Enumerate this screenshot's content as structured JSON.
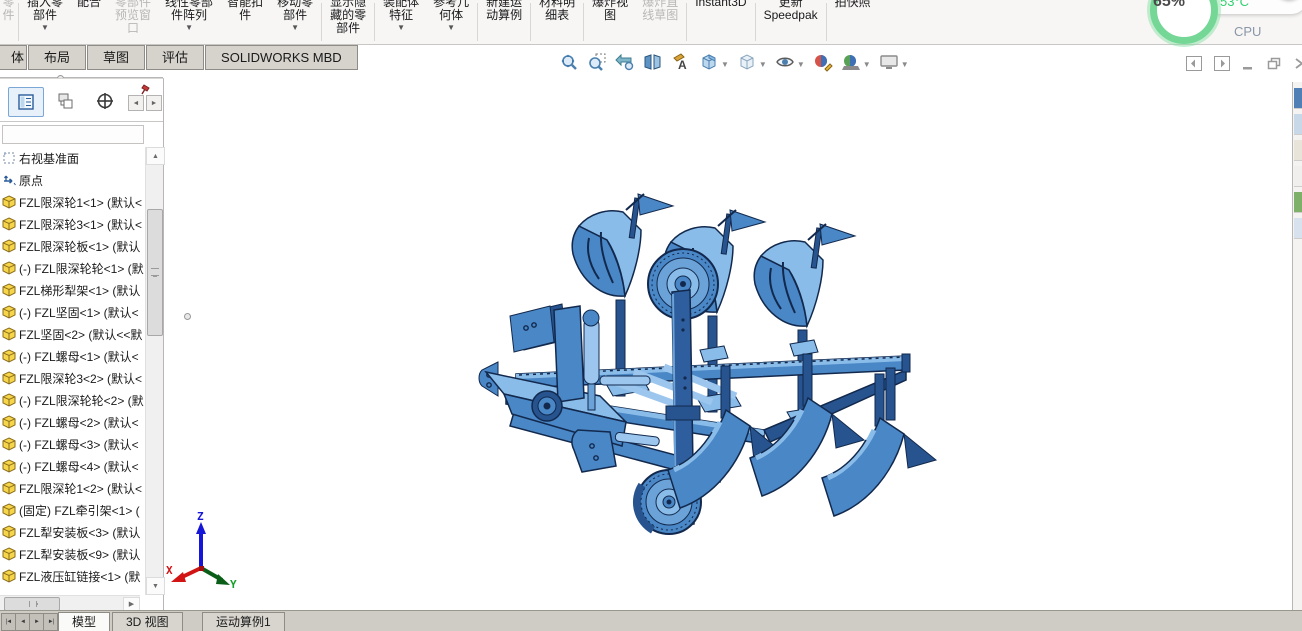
{
  "command_manager": {
    "partial_left": "零\n件",
    "buttons": [
      {
        "label": "插入零\n部件",
        "caret": true
      },
      {
        "label": "配合"
      },
      {
        "label": "零部件\n预览窗\n口",
        "disabled": true
      },
      {
        "label": "线性零部\n件阵列",
        "caret": true
      },
      {
        "label": "智能扣\n件"
      },
      {
        "label": "移动零\n部件",
        "caret": true,
        "sep_after": true
      },
      {
        "label": "显示隐\n藏的零\n部件",
        "sep_after": true
      },
      {
        "label": "装配体\n特征",
        "caret": true
      },
      {
        "label": "参考几\n何体",
        "caret": true,
        "sep_after": true
      },
      {
        "label": "新建运\n动算例",
        "sep_after": true
      },
      {
        "label": "材料明\n细表",
        "sep_after": true
      },
      {
        "label": "爆炸视\n图"
      },
      {
        "label": "爆炸直\n线草图",
        "disabled": true,
        "sep_after": true
      },
      {
        "label": "Instant3D",
        "sep_after": true
      },
      {
        "label": "更新\nSpeedpak",
        "sep_after": true
      },
      {
        "label": "拍快照"
      }
    ]
  },
  "ribbon_tabs": {
    "partial_first": "体",
    "tabs": [
      "布局",
      "草图",
      "评估",
      "SOLIDWORKS MBD"
    ]
  },
  "view_toolbar": [
    {
      "name": "zoom-to-fit-icon"
    },
    {
      "name": "zoom-to-area-icon"
    },
    {
      "name": "previous-view-icon"
    },
    {
      "name": "section-view-icon"
    },
    {
      "name": "annotation-views-icon"
    },
    {
      "name": "view-orientation-icon",
      "caret": true
    },
    {
      "name": "display-style-icon",
      "caret": true
    },
    {
      "name": "hide-show-items-icon",
      "caret": true
    },
    {
      "name": "edit-appearance-icon"
    },
    {
      "name": "apply-scene-icon",
      "caret": true
    },
    {
      "name": "view-settings-icon",
      "caret": true
    }
  ],
  "window_controls": [
    "pane-left",
    "pane-right",
    "minimize",
    "restore",
    "expand"
  ],
  "feature_panel": {
    "manager_tabs": [
      "featuremanager-tab",
      "displaymanager-tab",
      "configurationmanager-tab"
    ],
    "tree": [
      {
        "icon": "plane",
        "label": "右视基准面"
      },
      {
        "icon": "origin",
        "label": "原点"
      },
      {
        "icon": "part",
        "label": "FZL限深轮1<1> (默认<"
      },
      {
        "icon": "part",
        "label": "FZL限深轮3<1> (默认<"
      },
      {
        "icon": "part",
        "label": "FZL限深轮板<1> (默认"
      },
      {
        "icon": "part",
        "label": "(-) FZL限深轮轮<1> (默"
      },
      {
        "icon": "part",
        "label": "FZL梯形犁架<1> (默认"
      },
      {
        "icon": "part",
        "label": "(-) FZL坚固<1> (默认<"
      },
      {
        "icon": "part",
        "label": "FZL坚固<2> (默认<<默"
      },
      {
        "icon": "part",
        "label": "(-) FZL螺母<1> (默认<"
      },
      {
        "icon": "part",
        "label": "FZL限深轮3<2> (默认<"
      },
      {
        "icon": "part",
        "label": "(-) FZL限深轮轮<2> (默"
      },
      {
        "icon": "part",
        "label": "(-) FZL螺母<2> (默认<"
      },
      {
        "icon": "part",
        "label": "(-) FZL螺母<3> (默认<"
      },
      {
        "icon": "part",
        "label": "(-) FZL螺母<4> (默认<"
      },
      {
        "icon": "part",
        "label": "FZL限深轮1<2> (默认<"
      },
      {
        "icon": "part",
        "label": "(固定) FZL牵引架<1> ("
      },
      {
        "icon": "part",
        "label": "FZL犁安装板<3> (默认"
      },
      {
        "icon": "part",
        "label": "FZL犁安装板<9> (默认"
      },
      {
        "icon": "part",
        "label": "FZL液压缸链接<1> (默"
      }
    ]
  },
  "viewport": {
    "triad": {
      "x": "X",
      "y": "Y",
      "z": "Z"
    }
  },
  "bottom_bar": {
    "nav": [
      "first-tab",
      "prev-tab",
      "next-tab",
      "last-tab"
    ],
    "tabs": [
      {
        "label": "模型",
        "active": true
      },
      {
        "label": "3D 视图",
        "active": false
      },
      {
        "label": "运动算例1",
        "active": false
      }
    ]
  },
  "perf_widget": {
    "percent": "65%",
    "cpu_label": "CPU",
    "cpu_temp": "53°C"
  },
  "colors": {
    "model_mid": "#4a87c6",
    "model_light": "#8abce9",
    "model_mid2": "#6ba3d9",
    "model_dark": "#27548f",
    "model_outline": "#12294d",
    "accent_green": "#2fd06e",
    "axis_x": "#d21414",
    "axis_y": "#0b7d20",
    "axis_z": "#1616d8"
  }
}
